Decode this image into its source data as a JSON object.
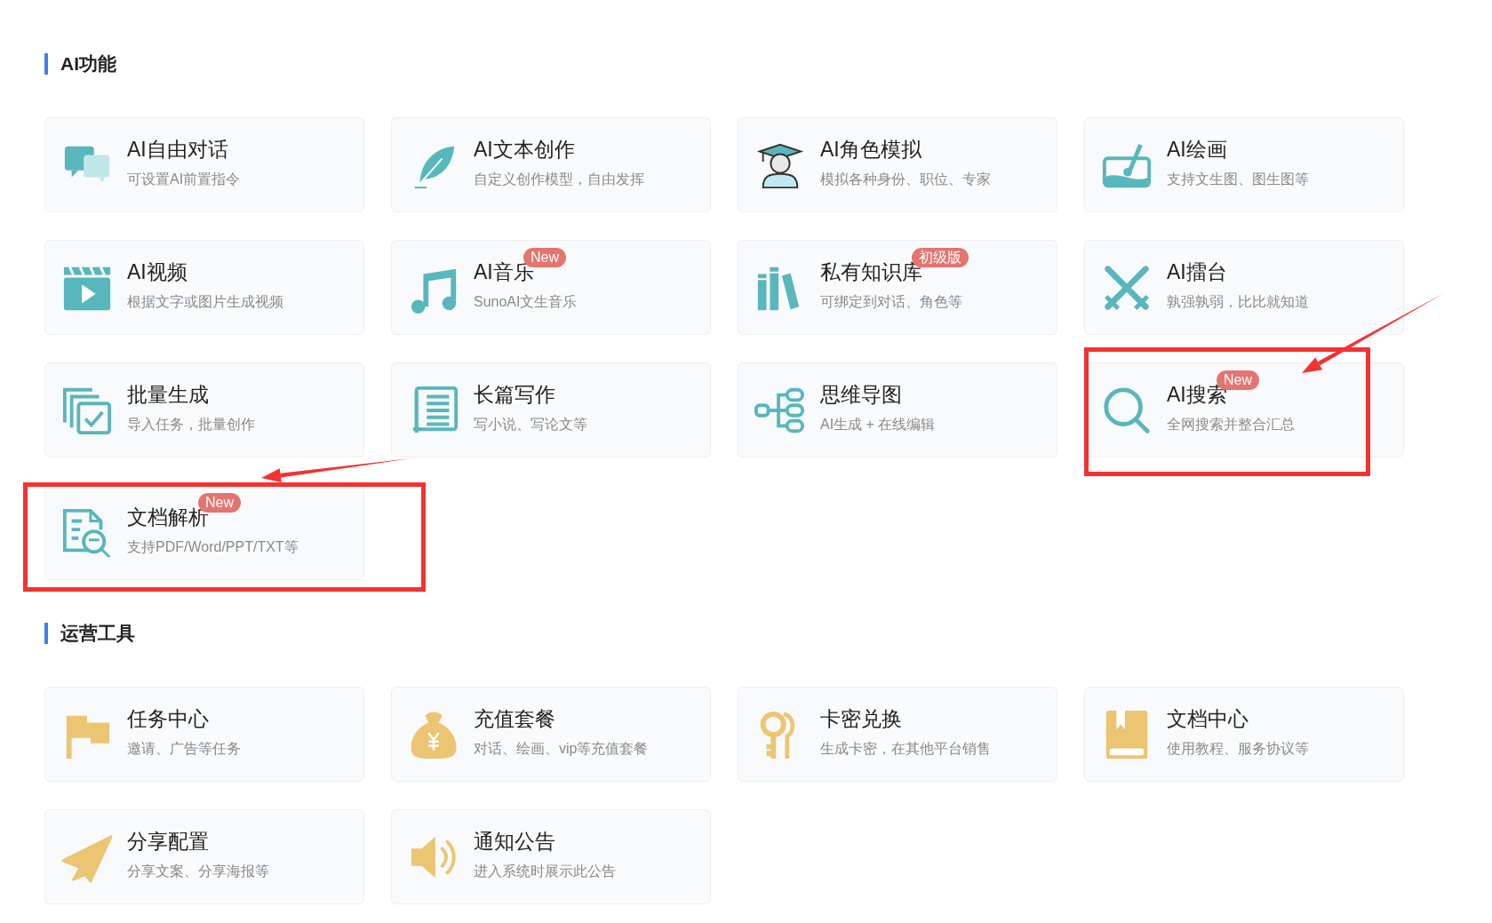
{
  "sections": [
    {
      "title": "AI功能",
      "items": [
        {
          "title": "AI自由对话",
          "subtitle": "可设置AI前置指令"
        },
        {
          "title": "AI文本创作",
          "subtitle": "自定义创作模型，自由发挥"
        },
        {
          "title": "AI角色模拟",
          "subtitle": "模拟各种身份、职位、专家"
        },
        {
          "title": "AI绘画",
          "subtitle": "支持文生图、图生图等"
        },
        {
          "title": "AI视频",
          "subtitle": "根据文字或图片生成视频"
        },
        {
          "title": "AI音乐",
          "subtitle": "SunoAI文生音乐",
          "badge": "New"
        },
        {
          "title": "私有知识库",
          "subtitle": "可绑定到对话、角色等",
          "badge": "初级版"
        },
        {
          "title": "AI擂台",
          "subtitle": "孰强孰弱，比比就知道"
        },
        {
          "title": "批量生成",
          "subtitle": "导入任务，批量创作"
        },
        {
          "title": "长篇写作",
          "subtitle": "写小说、写论文等"
        },
        {
          "title": "思维导图",
          "subtitle": "AI生成 + 在线编辑"
        },
        {
          "title": "AI搜索",
          "subtitle": "全网搜索并整合汇总",
          "badge": "New",
          "marked": true
        },
        {
          "title": "文档解析",
          "subtitle": "支持PDF/Word/PPT/TXT等",
          "badge": "New",
          "marked": true
        }
      ]
    },
    {
      "title": "运营工具",
      "items": [
        {
          "title": "任务中心",
          "subtitle": "邀请、广告等任务"
        },
        {
          "title": "充值套餐",
          "subtitle": "对话、绘画、vip等充值套餐"
        },
        {
          "title": "卡密兑换",
          "subtitle": "生成卡密，在其他平台销售"
        },
        {
          "title": "文档中心",
          "subtitle": "使用教程、服务协议等"
        },
        {
          "title": "分享配置",
          "subtitle": "分享文案、分享海报等"
        },
        {
          "title": "通知公告",
          "subtitle": "进入系统时展示此公告"
        }
      ]
    }
  ]
}
